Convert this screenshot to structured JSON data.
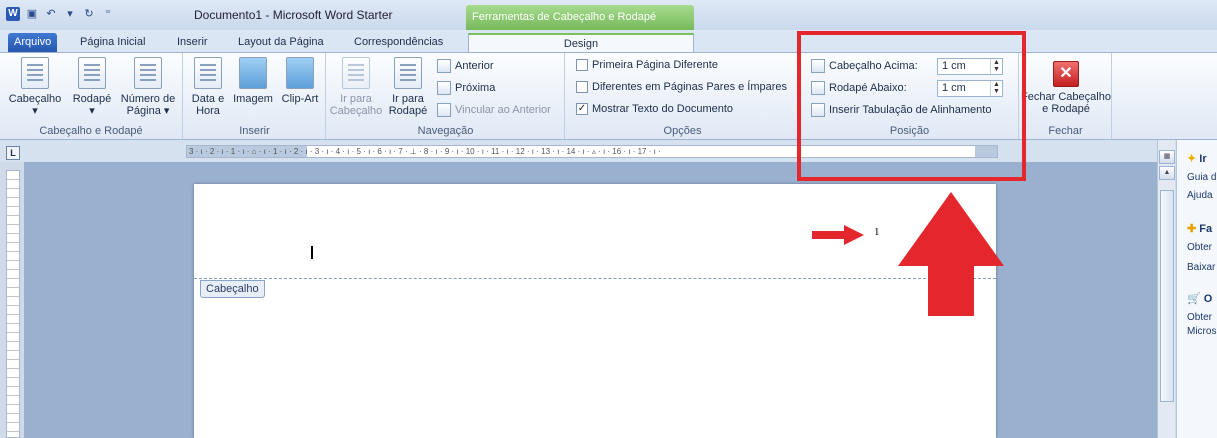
{
  "window": {
    "title": "Documento1  -  Microsoft Word Starter",
    "context_tab_header": "Ferramentas de Cabeçalho e Rodapé"
  },
  "tabs": [
    "Arquivo",
    "Página Inicial",
    "Inserir",
    "Layout da Página",
    "Correspondências",
    "Design"
  ],
  "ribbon": {
    "groups": {
      "header_footer": {
        "label": "Cabeçalho e Rodapé",
        "cabecalho": "Cabeçalho",
        "rodape": "Rodapé",
        "numero_l1": "Número de",
        "numero_l2": "Página"
      },
      "inserir": {
        "label": "Inserir",
        "data_l1": "Data e",
        "data_l2": "Hora",
        "imagem": "Imagem",
        "clipart": "Clip-Art"
      },
      "navegacao": {
        "label": "Navegação",
        "ir_cab_l1": "Ir para",
        "ir_cab_l2": "Cabeçalho",
        "ir_rod_l1": "Ir para",
        "ir_rod_l2": "Rodapé",
        "anterior": "Anterior",
        "proxima": "Próxima",
        "vincular": "Vincular ao Anterior"
      },
      "opcoes": {
        "label": "Opções",
        "primeira": "Primeira Página Diferente",
        "pares": "Diferentes em Páginas Pares e Ímpares",
        "mostrar": "Mostrar Texto do Documento",
        "mostrar_checked": "✓"
      },
      "posicao": {
        "label": "Posição",
        "cab_acima": "Cabeçalho Acima:",
        "cab_acima_value": "1 cm",
        "rod_abaixo": "Rodapé Abaixo:",
        "rod_abaixo_value": "1 cm",
        "inserir_tab": "Inserir Tabulação de Alinhamento"
      },
      "fechar": {
        "label": "Fechar",
        "btn_l1": "Fechar Cabeçalho",
        "btn_l2": "e Rodapé"
      }
    }
  },
  "ruler": {
    "corner": "L",
    "marks": "3 · ı · 2 · ı · 1 · ı · ⌂ · ı · 1 · ı · 2 · ı · 3 · ı · 4 · ı · 5 · ı · 6 · ı · 7 · ⊥ · 8 · ı · 9 · ı · 10 · ı · 11 · ı · 12 · ı · 13 · ı · 14 · ı · ▵ · ı · 16 · ı · 17 · ı ·"
  },
  "document": {
    "page_number": "1",
    "header_tag": "Cabeçalho"
  },
  "taskpane": {
    "h1": "Ir",
    "l1": "Guia d",
    "l2": "Ajuda",
    "h2": "Fa",
    "l3": "Obter",
    "l4": "Baixar",
    "h3": "O",
    "l5": "Obter",
    "l6": "Micros"
  },
  "annotation_colors": {
    "red": "#e3272d"
  }
}
